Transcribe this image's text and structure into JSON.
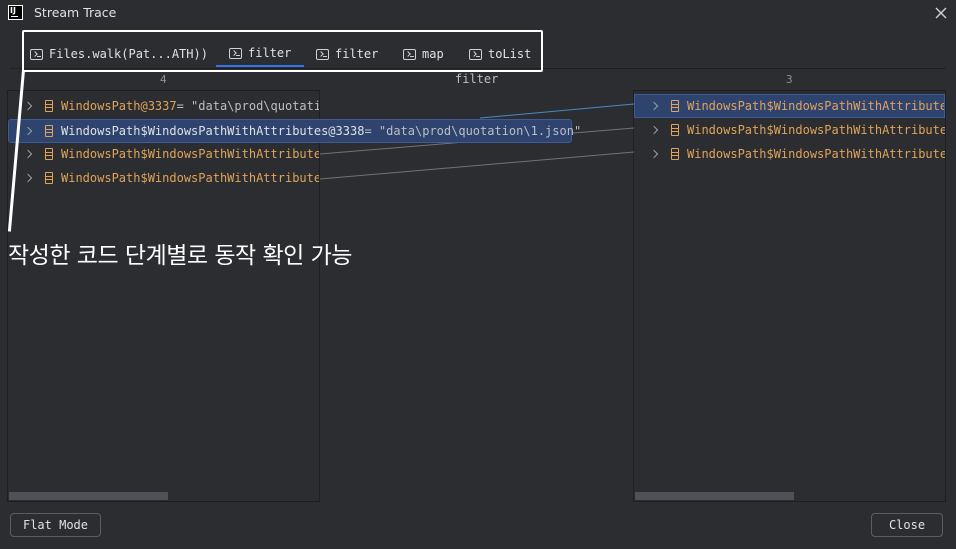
{
  "window": {
    "title": "Stream Trace",
    "logo_text": "IJ"
  },
  "tabs": [
    {
      "label": "Files.walk(Pat...ATH))",
      "active": false
    },
    {
      "label": "filter",
      "active": true
    },
    {
      "label": "filter",
      "active": false
    },
    {
      "label": "map",
      "active": false
    },
    {
      "label": "toList",
      "active": false
    }
  ],
  "columns": {
    "left_count": "4",
    "center_name": "filter",
    "right_count": "3"
  },
  "left_panel": {
    "rows": [
      {
        "ref": "WindowsPath@3337",
        "value": " = \"data\\prod\\quotati"
      },
      {
        "ref": "WindowsPath$WindowsPathWithAttributes@3338",
        "value": " = \"data\\prod\\quotation\\1.json\"",
        "selected": true
      },
      {
        "ref": "WindowsPath$WindowsPathWithAttributes",
        "value": ""
      },
      {
        "ref": "WindowsPath$WindowsPathWithAttributes",
        "value": ""
      }
    ]
  },
  "right_panel": {
    "rows": [
      {
        "ref": "WindowsPath$WindowsPathWithAttributes",
        "selected": true
      },
      {
        "ref": "WindowsPath$WindowsPathWithAttributes"
      },
      {
        "ref": "WindowsPath$WindowsPathWithAttributes"
      }
    ]
  },
  "annotation": {
    "text": "작성한 코드 단계별로 동작 확인 가능"
  },
  "buttons": {
    "flat_mode": "Flat Mode",
    "close": "Close"
  },
  "colors": {
    "background": "#2b2d30",
    "accent": "#3574f0",
    "selection": "#2e436e",
    "reference": "#e0a35a",
    "connector_active": "#4a88c7",
    "connector": "#6f737a"
  }
}
